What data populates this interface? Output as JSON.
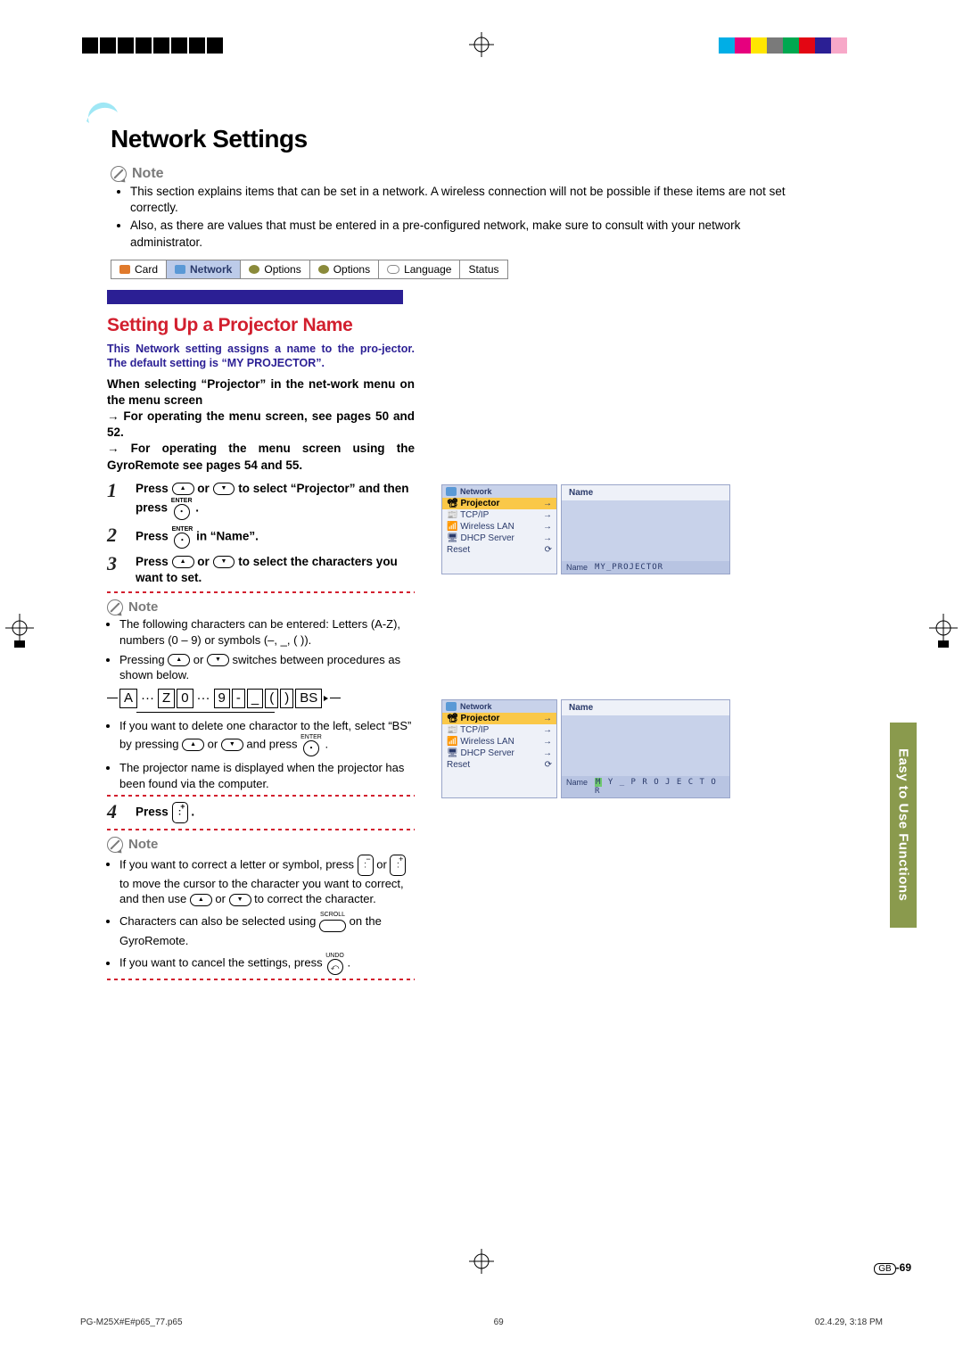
{
  "title": "Network Settings",
  "note_label": "Note",
  "intro_bullets": [
    "This section explains items that can be set in a network. A wireless connection will not be possible if these items are not set correctly.",
    "Also, as there are values that must be entered in a pre-configured network, make sure to consult with your network administrator."
  ],
  "menubar": {
    "items": [
      "Card",
      "Network",
      "Options",
      "Options",
      "Language",
      "Status"
    ],
    "selected_index": 1
  },
  "section": {
    "heading": "Setting Up a Projector Name",
    "lead": "This Network setting assigns a name to the pro-jector. The default setting is “MY PROJECTOR”.",
    "para1": "When selecting “Projector” in the net-work menu on the menu screen",
    "para2": "For operating the menu screen, see pages 50 and 52.",
    "para3": "For operating the menu screen using the GyroRemote see pages 54 and 55."
  },
  "steps": {
    "s1_a": "Press",
    "s1_b": "or",
    "s1_c": "to select “Projector” and then press",
    "s2_a": "Press",
    "s2_b": "in “Name”.",
    "s3_a": "Press",
    "s3_b": "or",
    "s3_c": "to select the characters you want to set.",
    "s4_a": "Press"
  },
  "enter_label": "ENTER",
  "undo_label": "UNDO",
  "scroll_label": "SCROLL",
  "note1_bullets": {
    "a": "The following characters can be entered: Letters (A-Z), numbers (0 – 9) or symbols (–, _, ( )).",
    "b1": "Pressing",
    "b2": "or",
    "b3": "switches between procedures as shown below.",
    "c1": "If you want to delete one charactor to the left, select “BS” by pressing",
    "c2": "or",
    "c3": "and press",
    "d": "The projector name is displayed when the projector has been found via the computer."
  },
  "char_seq": [
    "A",
    "Z",
    "0",
    "9",
    "-",
    "_",
    "(",
    ")",
    "BS"
  ],
  "note2_bullets": {
    "a1": "If you want to correct a letter or symbol, press",
    "a2": "or",
    "a3": "to move the cursor to the character you want to correct, and then use",
    "a4": "or",
    "a5": "to correct the character.",
    "b1": "Characters can also be selected using",
    "b2": "on the GyroRemote.",
    "c1": "If you want to cancel the settings, press"
  },
  "screenshots": {
    "net_head": "Network",
    "menu_items": [
      "Projector",
      "TCP/IP",
      "Wireless LAN",
      "DHCP Server",
      "Reset"
    ],
    "right_label": "Name",
    "footer_name_label": "Name",
    "value1": "MY_PROJECTOR",
    "value2_prefix": "M",
    "value2_suffix": "Y _ P R O J E C T O R"
  },
  "sidetab": "Easy to Use Functions",
  "pagenum": "-69",
  "region_code": "GB",
  "print_footer": {
    "file": "PG-M25X#E#p65_77.p65",
    "sheet": "69",
    "datetime": "02.4.29, 3:18 PM"
  },
  "color_swatches": [
    "#00aee6",
    "#e6007e",
    "#ffe600",
    "#7a7a7a",
    "#00a850",
    "#e30613",
    "#2b1f94",
    "#f7a8c8"
  ]
}
